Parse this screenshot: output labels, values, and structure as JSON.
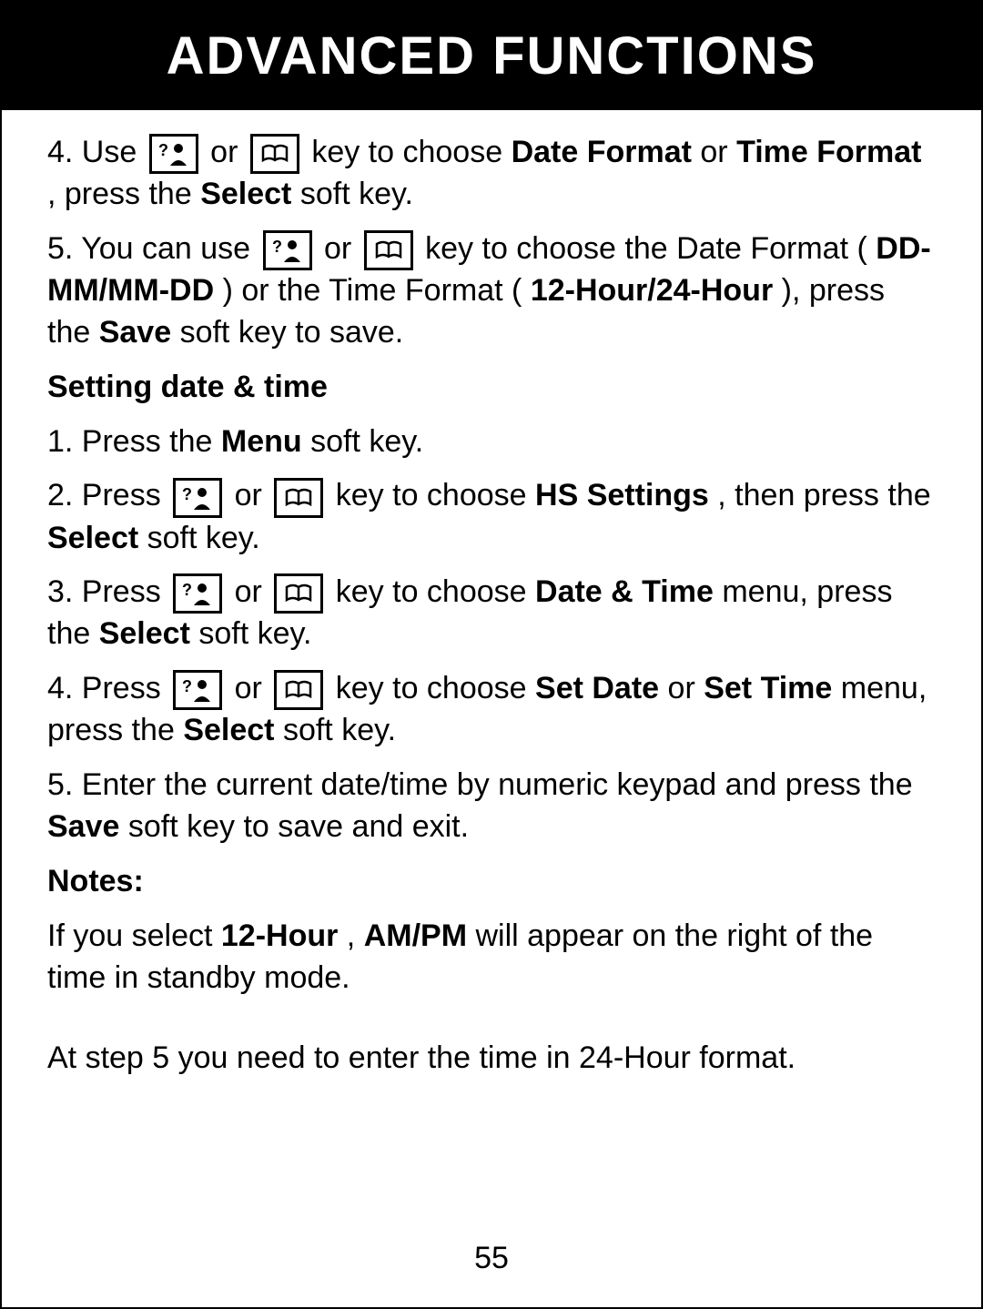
{
  "header": {
    "title": "ADVANCED FUNCTIONS"
  },
  "step4": {
    "prefix": "4. Use ",
    "or": " or ",
    "mid": " key to choose ",
    "df": "Date Format",
    "or2": " or ",
    "tf": "Time Format",
    "tail1": ", press the ",
    "select": "Select",
    "tail2": " soft key."
  },
  "step5": {
    "prefix": "5. You can use ",
    "or": " or ",
    "mid": " key to choose the Date Format (",
    "ddmm": "DD-MM/MM-DD",
    "mid2": ") or the Time Format (",
    "hr": "12-Hour/24-Hour",
    "mid3": "), press the ",
    "save": "Save",
    "tail": " soft key to save."
  },
  "section2": {
    "heading": "Setting date & time"
  },
  "s2step1": {
    "prefix": "1. Press the ",
    "menu": "Menu",
    "tail": " soft key."
  },
  "s2step2": {
    "prefix": "2. Press ",
    "or": " or ",
    "mid": " key to choose ",
    "hs": "HS Settings",
    "mid2": ", then press the ",
    "select": "Select",
    "tail": " soft key."
  },
  "s2step3": {
    "prefix": "3. Press ",
    "or": " or ",
    "mid": " key to choose ",
    "dt": "Date & Time",
    "mid2": " menu, press the ",
    "select": "Select",
    "tail": " soft key."
  },
  "s2step4": {
    "prefix": "4. Press ",
    "or": " or ",
    "mid": " key to choose ",
    "sd": "Set Date",
    "or2": " or ",
    "st": "Set Time",
    "mid2": " menu, press the ",
    "select": "Select",
    "tail": " soft key."
  },
  "s2step5": {
    "prefix": "5. Enter the current date/time by numeric keypad and press the ",
    "save": "Save",
    "tail": " soft key to save and exit."
  },
  "notes": {
    "heading": "Notes:",
    "n1a": "If you select ",
    "n1b": "12-Hour",
    "n1c": ", ",
    "n1d": "AM/PM",
    "n1e": " will appear on the right of the time in standby mode.",
    "n2": "At step 5 you need to enter the time in 24-Hour format."
  },
  "pageNumber": "55"
}
